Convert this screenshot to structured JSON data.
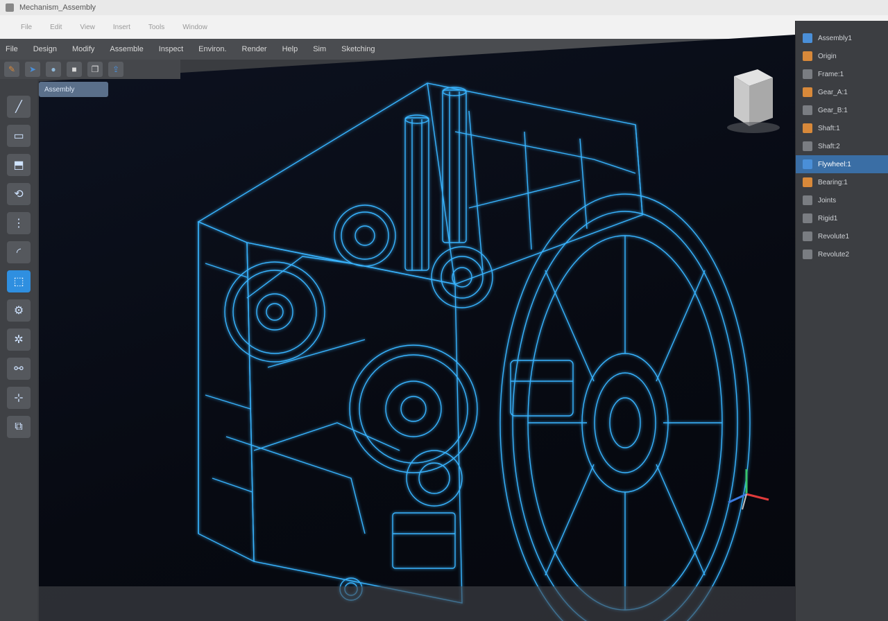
{
  "window": {
    "title": "Mechanism_Assembly"
  },
  "docbar": {
    "items": [
      "File",
      "Edit",
      "View",
      "Insert",
      "Tools",
      "Window"
    ]
  },
  "menubar": {
    "items": [
      "File",
      "Design",
      "Modify",
      "Assemble",
      "Inspect",
      "Environ.",
      "Render",
      "Help",
      "Sim",
      "Sketching"
    ]
  },
  "toolbar": {
    "buttons": [
      {
        "icon": "pencil-icon",
        "glyph": "✎",
        "color": "#d8893a"
      },
      {
        "icon": "select-icon",
        "glyph": "➤",
        "color": "#4a8fd8"
      },
      {
        "icon": "sphere-icon",
        "glyph": "●",
        "color": "#8fb8d8"
      },
      {
        "icon": "box-icon",
        "glyph": "■",
        "color": "#d8d8d8"
      },
      {
        "icon": "copy-icon",
        "glyph": "❐",
        "color": "#d8d8d8"
      },
      {
        "icon": "export-icon",
        "glyph": "⇪",
        "color": "#4a8fd8"
      }
    ]
  },
  "sidebar": {
    "items": [
      {
        "icon": "line-tool-icon",
        "glyph": "╱"
      },
      {
        "icon": "rectangle-tool-icon",
        "glyph": "▭"
      },
      {
        "icon": "extrude-tool-icon",
        "glyph": "⬒"
      },
      {
        "icon": "revolve-tool-icon",
        "glyph": "⟲"
      },
      {
        "icon": "pattern-tool-icon",
        "glyph": "⋮"
      },
      {
        "icon": "fillet-tool-icon",
        "glyph": "◜"
      },
      {
        "icon": "sketch-tool-icon",
        "glyph": "⬚",
        "active": true
      },
      {
        "icon": "gear-icon",
        "glyph": "⚙"
      },
      {
        "icon": "cog-icon",
        "glyph": "✲"
      },
      {
        "icon": "mate-icon",
        "glyph": "⚯"
      },
      {
        "icon": "measure-icon",
        "glyph": "⊹"
      },
      {
        "icon": "section-icon",
        "glyph": "⧉"
      }
    ]
  },
  "viewport": {
    "tab_label": "Assembly",
    "render_mode": "wireframe",
    "wire_color": "#39b4ff",
    "background_color": "#070a12"
  },
  "browser": {
    "items": [
      {
        "label": "Assembly1",
        "icon": "assembly-icon",
        "color": "blue"
      },
      {
        "label": "Origin",
        "icon": "origin-icon",
        "color": "orange"
      },
      {
        "label": "Frame:1",
        "icon": "part-icon",
        "color": "gray"
      },
      {
        "label": "Gear_A:1",
        "icon": "part-icon",
        "color": "orange"
      },
      {
        "label": "Gear_B:1",
        "icon": "part-icon",
        "color": "gray"
      },
      {
        "label": "Shaft:1",
        "icon": "part-icon",
        "color": "orange"
      },
      {
        "label": "Shaft:2",
        "icon": "part-icon",
        "color": "gray"
      },
      {
        "label": "Flywheel:1",
        "icon": "part-icon",
        "color": "blue",
        "selected": true
      },
      {
        "label": "Bearing:1",
        "icon": "part-icon",
        "color": "orange"
      },
      {
        "label": "Joints",
        "icon": "joint-icon",
        "color": "gray"
      },
      {
        "label": "Rigid1",
        "icon": "joint-icon",
        "color": "gray"
      },
      {
        "label": "Revolute1",
        "icon": "joint-icon",
        "color": "gray"
      },
      {
        "label": "Revolute2",
        "icon": "joint-icon",
        "color": "gray"
      }
    ]
  }
}
